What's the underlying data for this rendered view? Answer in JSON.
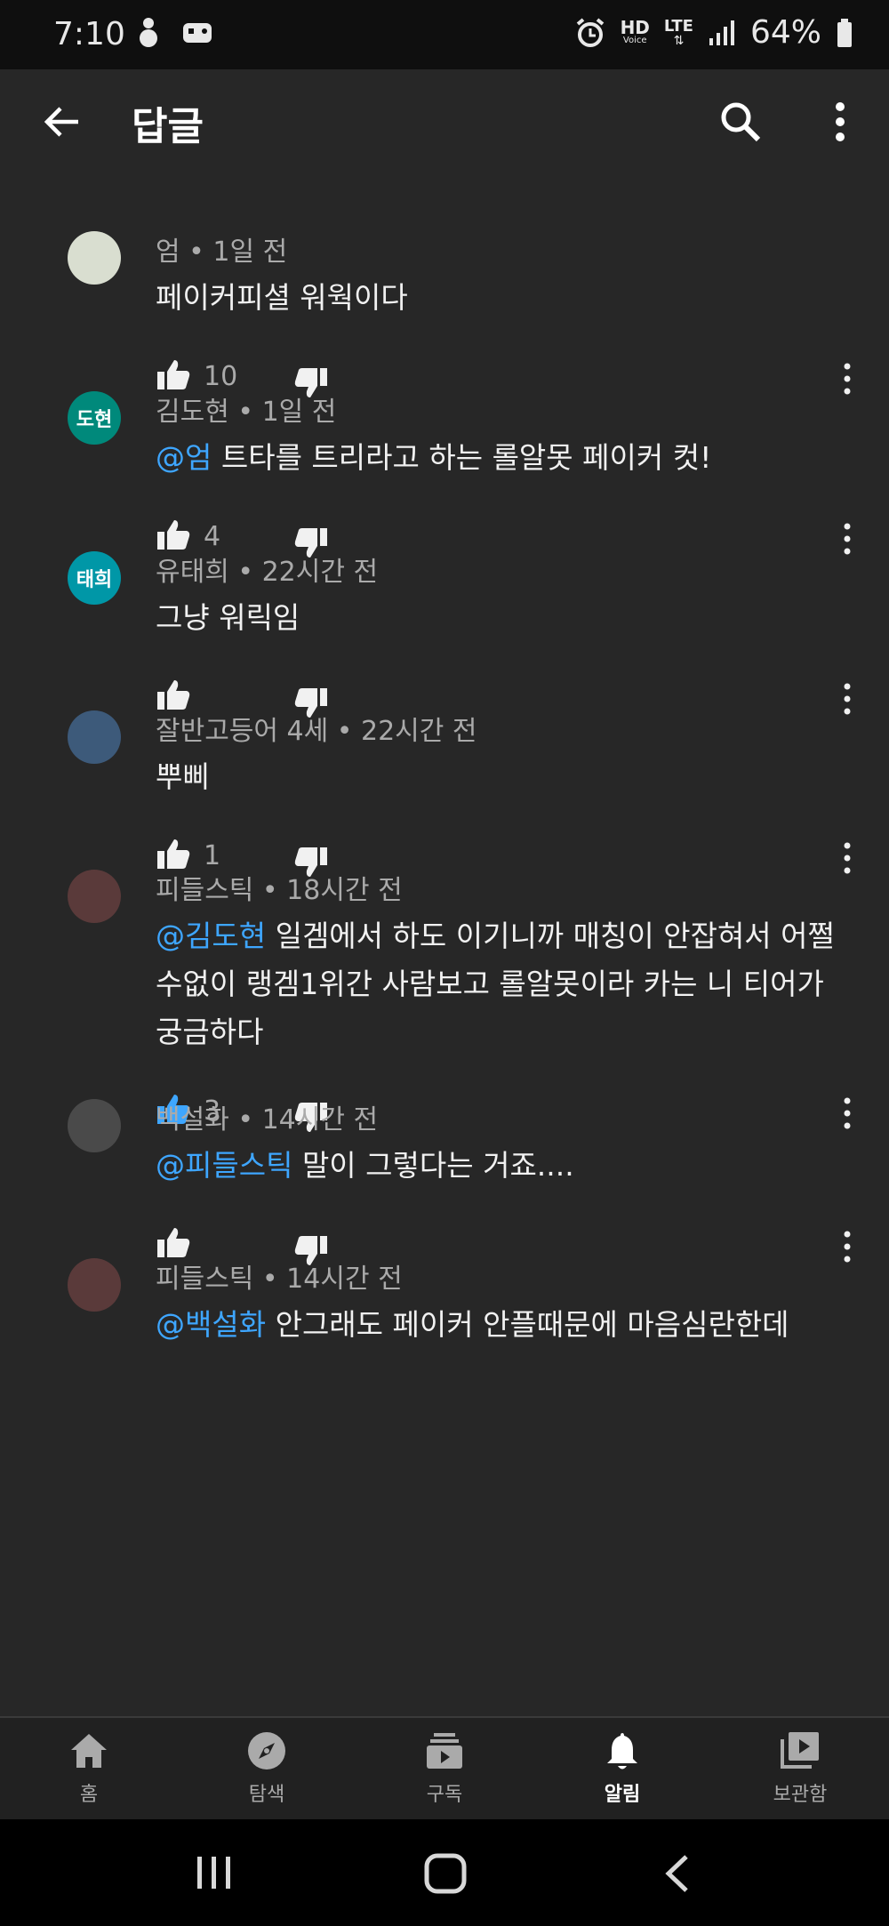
{
  "status_bar": {
    "time": "7:10",
    "hd_label": "HD",
    "hd_sub": "Voice",
    "lte_label": "LTE",
    "battery": "64%"
  },
  "app_bar": {
    "title": "답글"
  },
  "comments": [
    {
      "meta": "엄 • 1일 전",
      "mention": "",
      "text": "페이커피셜 워웍이다",
      "likes": "10",
      "avatar_text": "",
      "avatar_color": "#d9ded0"
    },
    {
      "meta": "김도현 • 1일 전",
      "mention": "@엄",
      "text": " 트타를 트리라고 하는 롤알못 페이커 컷!",
      "likes": "4",
      "avatar_text": "도현",
      "avatar_color": "#00897b"
    },
    {
      "meta": "유태희 • 22시간 전",
      "mention": "",
      "text": "그냥 워릭임",
      "likes": "",
      "avatar_text": "태희",
      "avatar_color": "#0097a7"
    },
    {
      "meta": "잘반고등어 4세 • 22시간 전",
      "mention": "",
      "text": "뿌삐",
      "likes": "1",
      "avatar_text": "",
      "avatar_color": "#3d5a7a"
    },
    {
      "meta": "피들스틱 • 18시간 전",
      "mention": "@김도현",
      "text": " 일겜에서 하도 이기니까 매칭이 안잡혀서 어쩔수없이 랭겜1위간 사람보고 롤알못이라 카는 니 티어가 궁금하다",
      "likes": "3",
      "avatar_text": "",
      "avatar_color": "#5a3a3a"
    },
    {
      "meta": "백설화 • 14시간 전",
      "mention": "@피들스틱",
      "text": " 말이 그렇다는 거죠....",
      "likes": "",
      "avatar_text": "",
      "avatar_color": "#4a4a4a"
    },
    {
      "meta": "피들스틱 • 14시간 전",
      "mention": "@백설화",
      "text": " 안그래도 페이커 안플때문에 마음심란한데",
      "likes": "",
      "avatar_text": "",
      "avatar_color": "#5a3a3a"
    }
  ],
  "bottom_nav": [
    {
      "label": "홈",
      "icon": "home-icon"
    },
    {
      "label": "탐색",
      "icon": "explore-icon"
    },
    {
      "label": "구독",
      "icon": "subscriptions-icon"
    },
    {
      "label": "알림",
      "icon": "notifications-icon",
      "active": true
    },
    {
      "label": "보관함",
      "icon": "library-icon"
    }
  ],
  "colors": {
    "background": "#272727",
    "mention": "#3ea6ff",
    "liked": "#3ea6ff",
    "secondary_text": "#aaaaaa"
  }
}
